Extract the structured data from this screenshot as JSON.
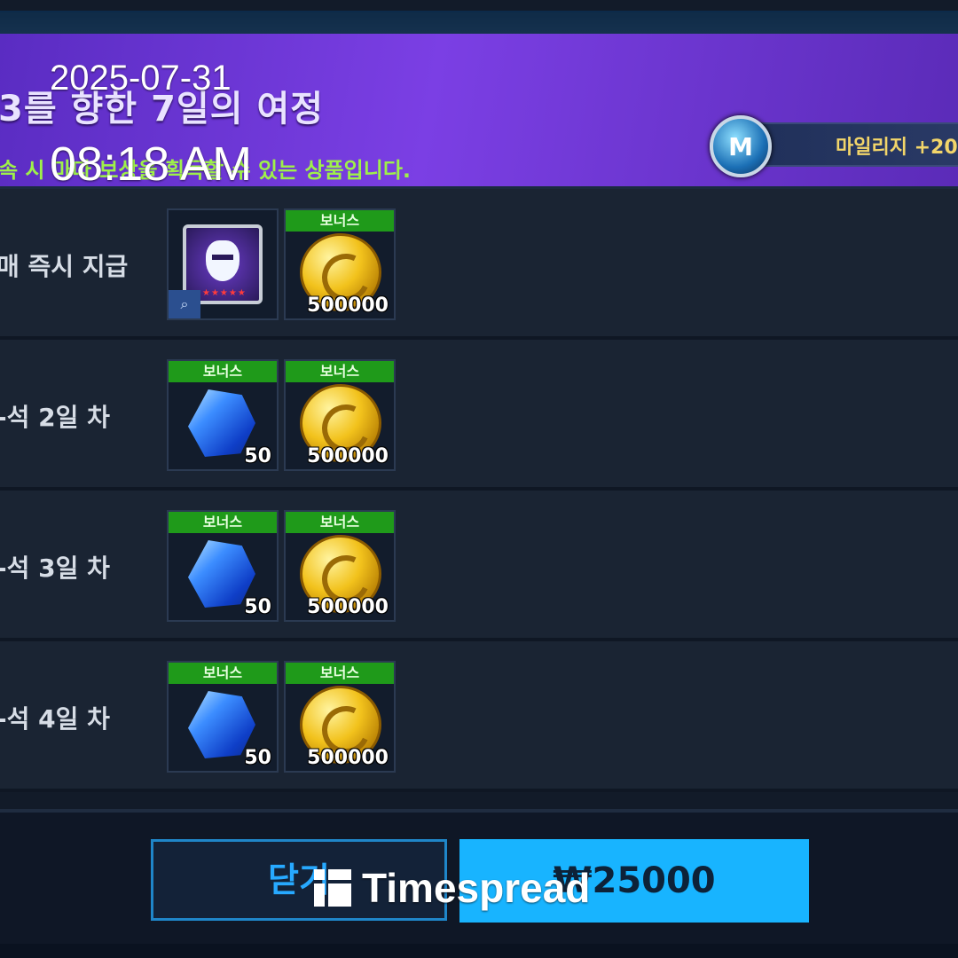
{
  "header": {
    "title": "3를 향한 7일의 여정",
    "subtitle": "속 시 마다 보상을 획득할 수 있는 상품입니다.",
    "mileage_label": "마일리지 +20"
  },
  "overlay": {
    "date": "2025-07-31",
    "time": "08:18 AM"
  },
  "rows": [
    {
      "label": "매 즉시 지급",
      "items": [
        {
          "kind": "hero-card",
          "bonus": "",
          "qty": ""
        },
        {
          "kind": "gold-coin",
          "bonus": "보너스",
          "qty": "500000"
        }
      ]
    },
    {
      "label": "-석 2일 차",
      "items": [
        {
          "kind": "blue-gem",
          "bonus": "보너스",
          "qty": "50"
        },
        {
          "kind": "gold-coin",
          "bonus": "보너스",
          "qty": "500000"
        }
      ]
    },
    {
      "label": "-석 3일 차",
      "items": [
        {
          "kind": "blue-gem",
          "bonus": "보너스",
          "qty": "50"
        },
        {
          "kind": "gold-coin",
          "bonus": "보너스",
          "qty": "500000"
        }
      ]
    },
    {
      "label": "-석 4일 차",
      "items": [
        {
          "kind": "blue-gem",
          "bonus": "보너스",
          "qty": "50"
        },
        {
          "kind": "gold-coin",
          "bonus": "보너스",
          "qty": "500000"
        }
      ]
    }
  ],
  "footer": {
    "close_label": "닫기",
    "price_label": "₩25000",
    "brand": "Timespread"
  },
  "colors": {
    "header_purple": "#7b3fe4",
    "bonus_green": "#1f9a1a",
    "price_blue": "#18b4ff",
    "subtitle_green": "#9ef04a"
  }
}
